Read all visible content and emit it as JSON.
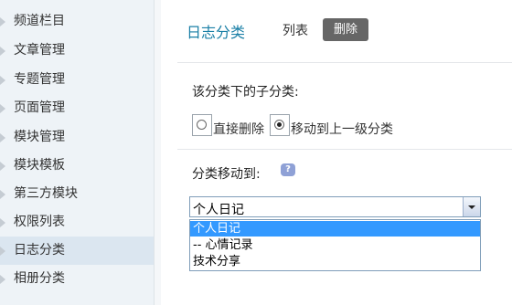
{
  "sidebar": {
    "items": [
      {
        "label": "频道栏目"
      },
      {
        "label": "文章管理"
      },
      {
        "label": "专题管理"
      },
      {
        "label": "页面管理"
      },
      {
        "label": "模块管理"
      },
      {
        "label": "模块模板"
      },
      {
        "label": "第三方模块"
      },
      {
        "label": "权限列表"
      },
      {
        "label": "日志分类",
        "active": true
      },
      {
        "label": "相册分类"
      }
    ]
  },
  "header": {
    "title": "日志分类",
    "tabs": [
      {
        "label": "列表"
      },
      {
        "label": "删除",
        "active": true
      }
    ]
  },
  "form": {
    "subcategory_heading": "该分类下的子分类:",
    "options": {
      "delete_direct": "直接删除",
      "move_up": "移动到上一级分类",
      "selected": "move_up"
    },
    "move_to_label": "分类移动到:",
    "help_icon": "help-icon",
    "select": {
      "value": "个人日记",
      "options": [
        "个人日记",
        "-- 心情记录",
        "技术分享"
      ],
      "highlighted_index": 0
    }
  },
  "colors": {
    "title": "#1a7fa6",
    "active_tab_bg": "#666666",
    "sidebar_bg": "#eef3f7",
    "highlight": "#3399ff"
  }
}
